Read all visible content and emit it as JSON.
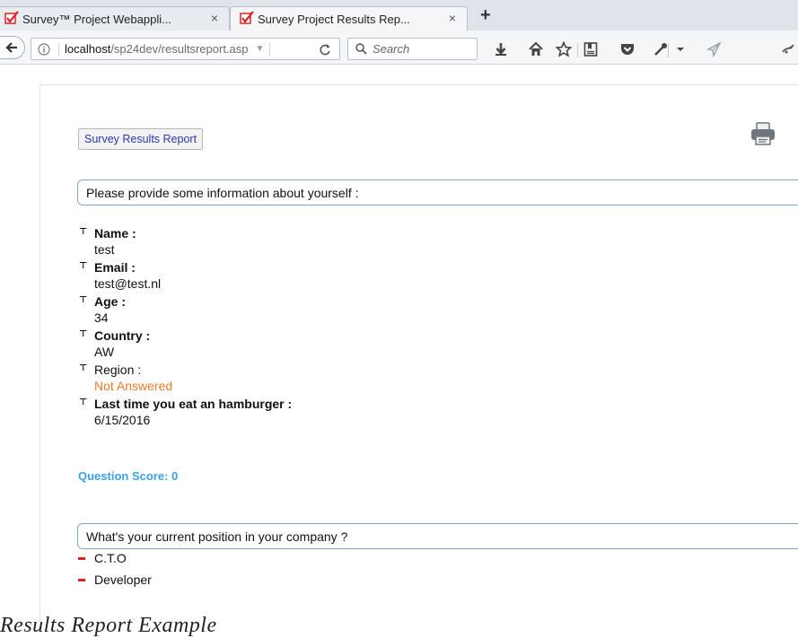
{
  "tabs": [
    {
      "title": "Survey™ Project Webappli...",
      "close": "×",
      "active": false
    },
    {
      "title": "Survey Project Results Rep...",
      "close": "×",
      "active": true
    }
  ],
  "newtab_symbol": "+",
  "urlbar": {
    "host": "localhost",
    "path": "/sp24dev/resultsreport.asp"
  },
  "search": {
    "placeholder": "Search"
  },
  "toolbar_icons": [
    "download-icon",
    "home-icon",
    "bookmark-star-icon",
    "reading-list-icon",
    "pocket-icon",
    "eyedropper-icon",
    "dropdown-icon",
    "send-icon",
    "extension-icon"
  ],
  "report": {
    "button_label": "Survey Results Report"
  },
  "question1": {
    "text": "Please provide some information about yourself :",
    "answers": [
      {
        "label": "Name :",
        "value": "test"
      },
      {
        "label": "Email :",
        "value": "test@test.nl"
      },
      {
        "label": "Age :",
        "value": "34"
      },
      {
        "label": "Country :",
        "value": "AW"
      },
      {
        "label": "Region :",
        "value": "Not Answered"
      },
      {
        "label": "Last time you eat an hamburger :",
        "value": "6/15/2016"
      }
    ],
    "score": "Question Score: 0"
  },
  "question2": {
    "text": "What's your current position in your company ?",
    "options": [
      "C.T.O",
      "Developer"
    ]
  },
  "caption": "Results Report Example",
  "colors": {
    "accent_link": "#2a3aa8",
    "not_answered": "#ee7a2a",
    "score": "#3da0e8",
    "option_dash": "#e02020",
    "question_border": "#7fa6c9"
  }
}
